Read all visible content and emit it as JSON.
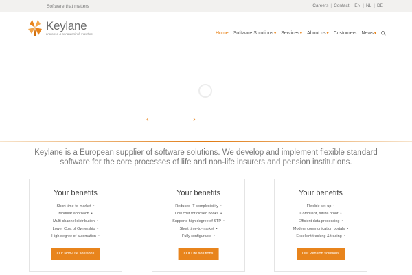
{
  "topbar": {
    "tagline": "Software that matters",
    "links": [
      "Careers",
      "Contact",
      "EN",
      "NL",
      "DE"
    ]
  },
  "brand": {
    "name": "Keylane",
    "subtitle": "software for insurance & pensions",
    "accent": "#e8841c"
  },
  "nav": {
    "items": [
      "Home",
      "Software Solutions",
      "Services",
      "About us",
      "Customers",
      "News"
    ],
    "active": "Home"
  },
  "intro": "Keylane is a European supplier of software solutions. We develop and implement flexible standard software for the core processes of life and non-life insurers and pension institutions.",
  "cards": [
    {
      "title": "Your benefits",
      "benefits": [
        "Short time-to-market",
        "Modular approach",
        "Multi-channel distribution",
        "Lower Cost of Ownership",
        "High degree of automation"
      ],
      "button": "Our Non-Life solutions"
    },
    {
      "title": "Your benefits",
      "benefits": [
        "Reduced IT-complexibility",
        "Low cost for closed books",
        "Supports high degree of STP",
        "Short time-to-market",
        "Fully configurable"
      ],
      "button": "Our Life solutions"
    },
    {
      "title": "Your benefits",
      "benefits": [
        "Flexible set-up",
        "Compliant, future proof",
        "Efficient data processing",
        "Modern communication portals",
        "Excellent tracking & tracing"
      ],
      "button": "Our Pension solutions"
    }
  ]
}
